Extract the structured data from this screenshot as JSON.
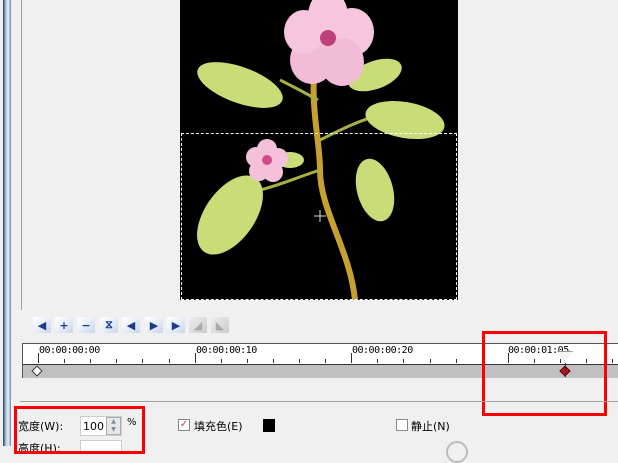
{
  "toolbar": {
    "buttons": [
      {
        "name": "go-to-start",
        "glyph": "◀"
      },
      {
        "name": "add-keyframe",
        "glyph": "+"
      },
      {
        "name": "delete-keyframe",
        "glyph": "−"
      },
      {
        "name": "reverse-keyframes",
        "glyph": "⧖"
      },
      {
        "name": "previous-keyframe",
        "glyph": "◀"
      },
      {
        "name": "next-keyframe",
        "glyph": "▶"
      },
      {
        "name": "go-to-end",
        "glyph": "▶"
      },
      {
        "name": "ease-in",
        "glyph": "◢"
      },
      {
        "name": "ease-out",
        "glyph": "◣"
      }
    ]
  },
  "timeline": {
    "labels": [
      "00:00:00:00",
      "00:00:00:10",
      "00:00:00:20",
      "00:00:01:05"
    ]
  },
  "properties": {
    "width_label": "宽度(W):",
    "width_value": "100",
    "width_unit": "%",
    "height_label": "高度(H):",
    "fill_color_label": "填充色(E)",
    "fill_color_checked": true,
    "fill_color": "#000000",
    "static_label": "静止(N)",
    "static_checked": false
  },
  "colors": {
    "highlight": "#ff0000",
    "keyframe_active": "#c0141e"
  }
}
